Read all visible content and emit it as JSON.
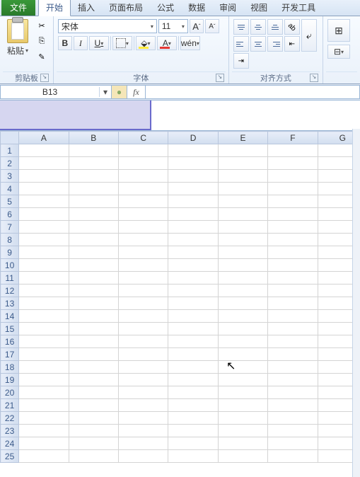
{
  "tabs": {
    "file": "文件",
    "home": "开始",
    "insert": "插入",
    "layout": "页面布局",
    "formula": "公式",
    "data": "数据",
    "review": "审阅",
    "view": "视图",
    "dev": "开发工具"
  },
  "ribbon": {
    "clipboard": {
      "label": "剪贴板",
      "paste": "粘贴"
    },
    "font": {
      "label": "字体",
      "name": "宋体",
      "size": "11",
      "bold": "B",
      "italic": "I",
      "underline": "U"
    },
    "align": {
      "label": "对齐方式"
    }
  },
  "namebox": {
    "value": "B13"
  },
  "formula_bar": {
    "fx": "fx",
    "value": ""
  },
  "columns": [
    "A",
    "B",
    "C",
    "D",
    "E",
    "F",
    "G"
  ],
  "rows": [
    "1",
    "2",
    "3",
    "4",
    "5",
    "6",
    "7",
    "8",
    "9",
    "10",
    "11",
    "12",
    "13",
    "14",
    "15",
    "16",
    "17",
    "18",
    "19",
    "20",
    "21",
    "22",
    "23",
    "24",
    "25"
  ],
  "icons": {
    "dd": "▾",
    "launcher": "↘",
    "scissors": "✂",
    "copy": "⎘",
    "brush": "✎",
    "grow": "A",
    "shrink": "A"
  }
}
